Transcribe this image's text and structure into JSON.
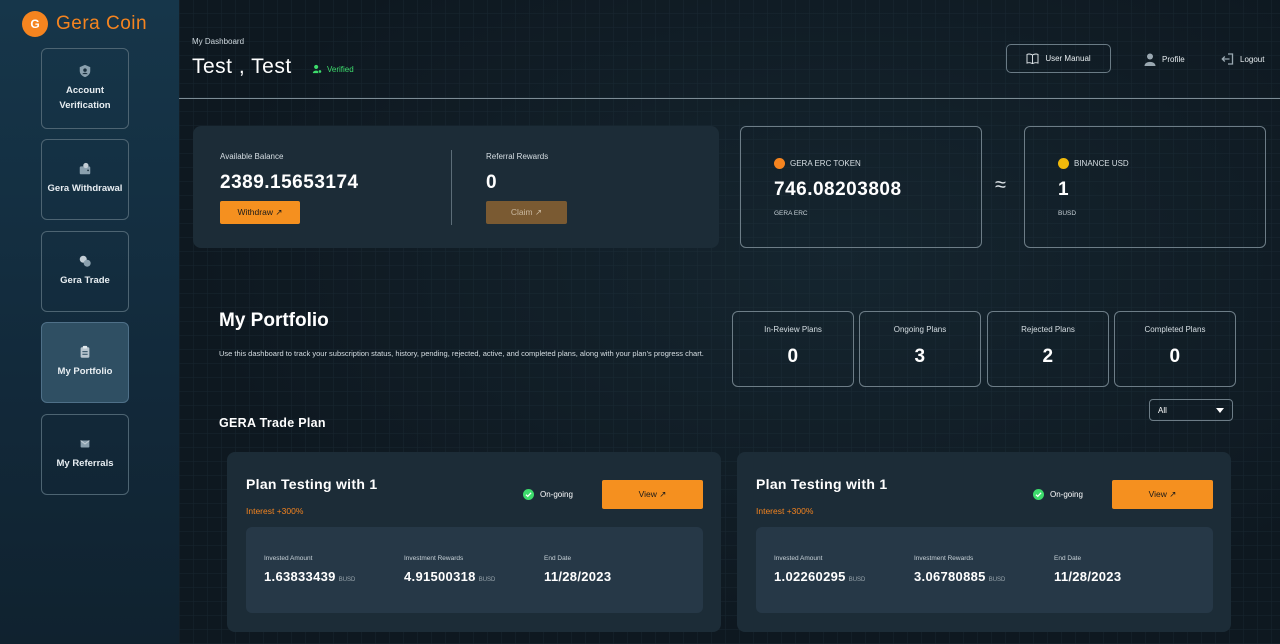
{
  "brand": {
    "logo_text": "Gera Coin",
    "accent": "#f5841f"
  },
  "sidebar": {
    "items": [
      {
        "label": "Account Verification",
        "icon": "user-shield-icon"
      },
      {
        "label": "Gera Withdrawal",
        "icon": "wallet-icon"
      },
      {
        "label": "Gera Trade",
        "icon": "trade-icon"
      },
      {
        "label": "My Portfolio",
        "icon": "clipboard-icon",
        "active": true
      },
      {
        "label": "My Referrals",
        "icon": "referral-icon"
      }
    ]
  },
  "header": {
    "breadcrumb": "My Dashboard",
    "title": "Test , Test",
    "verified": "Verified",
    "user_manual": "User Manual",
    "profile": "Profile",
    "logout": "Logout"
  },
  "balance": {
    "available_label": "Available Balance",
    "available_value": "2389.15653174",
    "withdraw": "Withdraw ↗",
    "referral_label": "Referral Rewards",
    "referral_value": "0",
    "claim": "Claim ↗"
  },
  "tokens": {
    "gera_label": "GERA ERC TOKEN",
    "gera_value": "746.08203808",
    "gera_unit": "GERA ERC",
    "approx": "≈",
    "busd_label": "BINANCE USD",
    "busd_value": "1",
    "busd_unit": "BUSD"
  },
  "portfolio": {
    "title": "My Portfolio",
    "description": "Use this dashboard to track your subscription status, history, pending, rejected, active, and completed plans, along with your plan's progress chart.",
    "stats": [
      {
        "label": "In-Review Plans",
        "value": "0"
      },
      {
        "label": "Ongoing Plans",
        "value": "3"
      },
      {
        "label": "Rejected Plans",
        "value": "2"
      },
      {
        "label": "Completed Plans",
        "value": "0"
      }
    ],
    "section_title": "GERA Trade Plan",
    "filter_value": "All"
  },
  "plans": [
    {
      "title": "Plan Testing with 1",
      "interest": "Interest +300%",
      "status": "On-going",
      "view": "View ↗",
      "invested_label": "Invested Amount",
      "invested_value": "1.63833439",
      "rewards_label": "Investment Rewards",
      "rewards_value": "4.91500318",
      "end_label": "End Date",
      "end_value": "11/28/2023",
      "unit": "BUSD"
    },
    {
      "title": "Plan Testing with 1",
      "interest": "Interest +300%",
      "status": "On-going",
      "view": "View ↗",
      "invested_label": "Invested Amount",
      "invested_value": "1.02260295",
      "rewards_label": "Investment Rewards",
      "rewards_value": "3.06780885",
      "end_label": "End Date",
      "end_value": "11/28/2023",
      "unit": "BUSD"
    }
  ]
}
